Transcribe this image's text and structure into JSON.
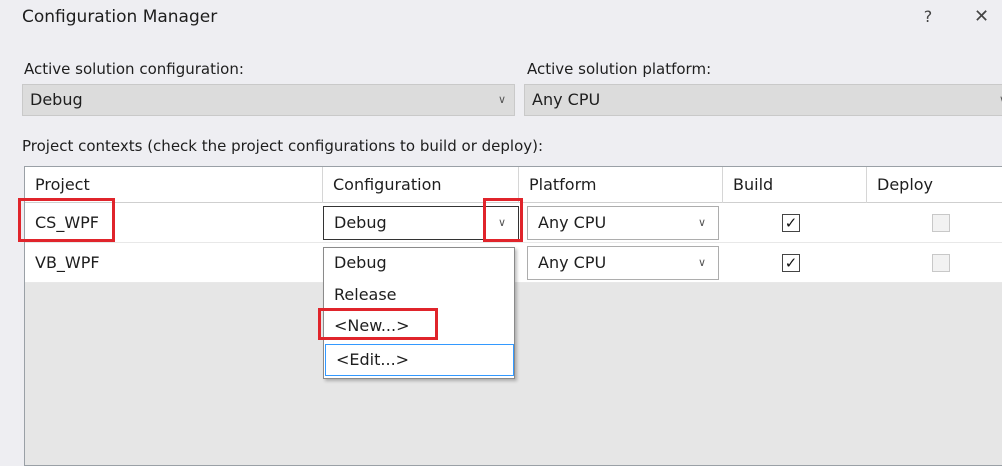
{
  "window": {
    "title": "Configuration Manager",
    "help_glyph": "?",
    "close_glyph": "✕"
  },
  "solution": {
    "config_label": "Active solution configuration:",
    "config_value": "Debug",
    "platform_label": "Active solution platform:",
    "platform_value": "Any CPU"
  },
  "contexts_label": "Project contexts (check the project configurations to build or deploy):",
  "grid": {
    "columns": [
      "Project",
      "Configuration",
      "Platform",
      "Build",
      "Deploy"
    ],
    "rows": [
      {
        "project": "CS_WPF",
        "configuration": "Debug",
        "platform": "Any CPU",
        "build": true,
        "deploy": false
      },
      {
        "project": "VB_WPF",
        "configuration": "",
        "platform": "Any CPU",
        "build": true,
        "deploy": false
      }
    ]
  },
  "dropdown": {
    "options": [
      "Debug",
      "Release",
      "<New...>",
      "<Edit...>"
    ]
  },
  "colors": {
    "highlight": "#e0242b",
    "focus": "#3399ff"
  },
  "icons": {
    "chevron": "chevron-down-icon",
    "check": "checkmark-icon"
  }
}
